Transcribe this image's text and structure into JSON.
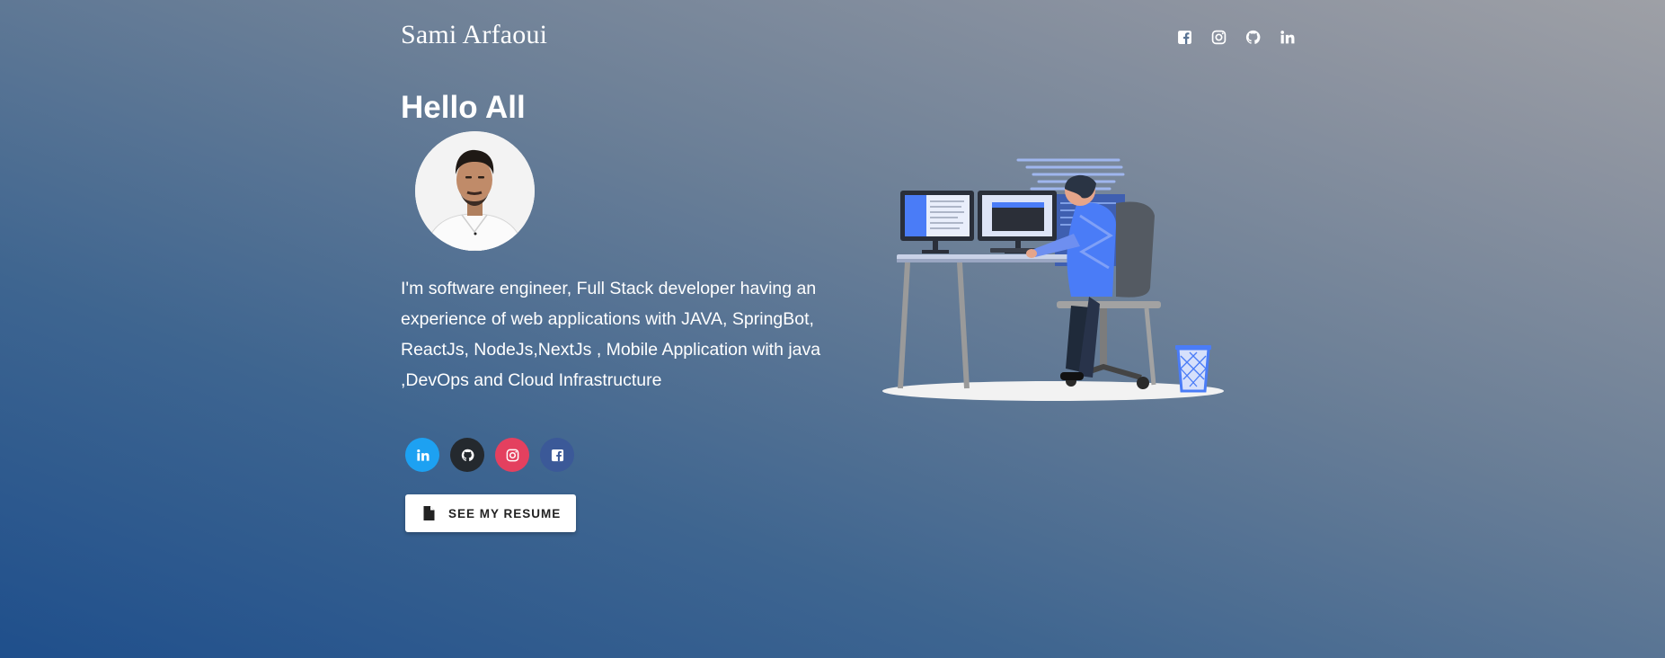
{
  "header": {
    "brand": "Sami Arfaoui",
    "icons": [
      "facebook-icon",
      "instagram-icon",
      "github-icon",
      "linkedin-icon"
    ]
  },
  "hero": {
    "title": "Hello All",
    "bio": "I'm software engineer, Full Stack developer having an experience of web applications with JAVA, SpringBot, ReactJs, NodeJs,NextJs , Mobile Application with java ,DevOps and Cloud Infrastructure"
  },
  "socials": [
    {
      "icon": "linkedin-icon",
      "color": "#1da1f2"
    },
    {
      "icon": "github-icon",
      "color": "#24292e"
    },
    {
      "icon": "instagram-icon",
      "color": "#e4405f"
    },
    {
      "icon": "facebook-icon",
      "color": "#3b5998"
    }
  ],
  "resume": {
    "label": "SEE MY RESUME",
    "icon": "file-icon"
  },
  "colors": {
    "accent": "#4a7cf7"
  }
}
